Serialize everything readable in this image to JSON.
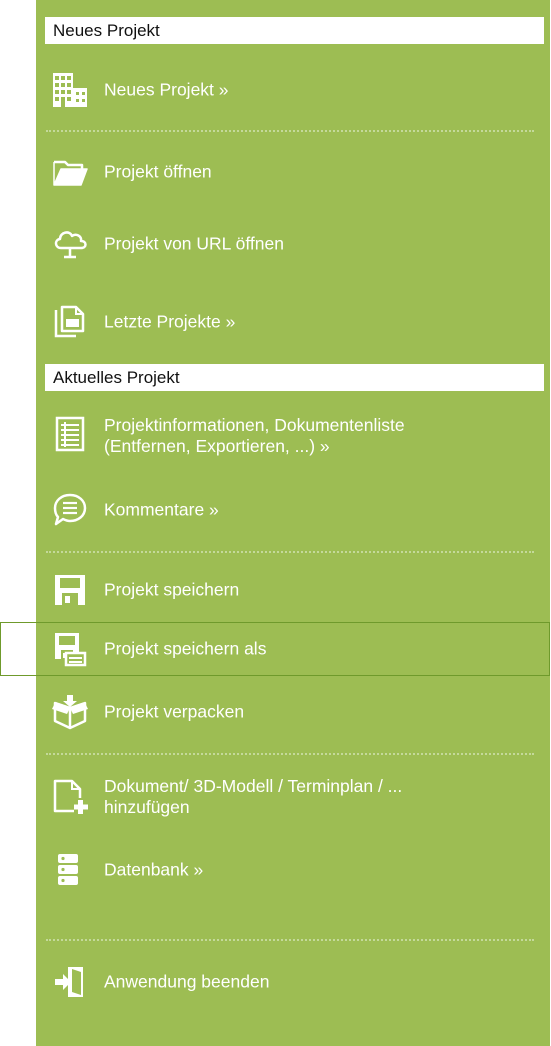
{
  "sections": {
    "new_project": {
      "title": "Neues Projekt"
    },
    "current_project": {
      "title": "Aktuelles Projekt"
    }
  },
  "items": {
    "new_project": {
      "label": "Neues Projekt »",
      "icon": "building-icon"
    },
    "open_project": {
      "label": "Projekt öffnen",
      "icon": "folder-open-icon"
    },
    "open_from_url": {
      "label": "Projekt von URL öffnen",
      "icon": "cloud-icon"
    },
    "recent_projects": {
      "label": "Letzte Projekte »",
      "icon": "recent-files-icon"
    },
    "project_info": {
      "label_line1": "Projektinformationen, Dokumentenliste",
      "label_line2": "(Entfernen, Exportieren, ...) »",
      "icon": "document-list-icon"
    },
    "comments": {
      "label": "Kommentare »",
      "icon": "comment-icon"
    },
    "save": {
      "label": "Projekt speichern",
      "icon": "save-icon"
    },
    "save_as": {
      "label": "Projekt speichern als",
      "icon": "save-as-icon"
    },
    "pack": {
      "label": "Projekt verpacken",
      "icon": "package-icon"
    },
    "add_document": {
      "label_line1": "Dokument/ 3D-Modell / Terminplan / ...",
      "label_line2": "hinzufügen",
      "icon": "add-document-icon"
    },
    "database": {
      "label": "Datenbank »",
      "icon": "database-icon"
    },
    "exit": {
      "label": "Anwendung beenden",
      "icon": "exit-icon"
    }
  },
  "colors": {
    "panel": "#9dbd53",
    "header_bg": "#ffffff",
    "text": "#ffffff",
    "separator": "#c4d99a",
    "highlight_border": "#6f9a2c"
  }
}
